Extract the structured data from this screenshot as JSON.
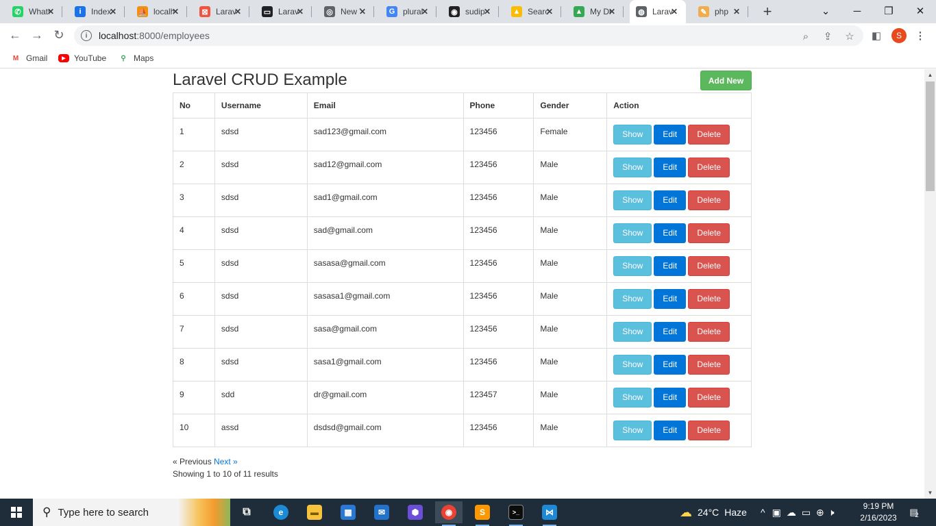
{
  "browser": {
    "tabs": [
      {
        "title": "WhatsApp",
        "icon": "whatsapp-icon",
        "color": "#25d366",
        "glyph": "✆",
        "active": false
      },
      {
        "title": "Index",
        "icon": "index-icon",
        "color": "#1a73e8",
        "glyph": "i",
        "active": false
      },
      {
        "title": "localhost",
        "icon": "phpmyadmin-icon",
        "color": "#f29111",
        "glyph": "⛵",
        "active": false
      },
      {
        "title": "Laravel",
        "icon": "laravel-icon",
        "color": "#f05340",
        "glyph": "⊠",
        "active": false
      },
      {
        "title": "Laravel",
        "icon": "laracasts-icon",
        "color": "#202124",
        "glyph": "▭",
        "active": false
      },
      {
        "title": "New Tab",
        "icon": "chrome-icon",
        "color": "#5f6368",
        "glyph": "◎",
        "active": false
      },
      {
        "title": "plural",
        "icon": "google-icon",
        "color": "#4285f4",
        "glyph": "G",
        "active": false
      },
      {
        "title": "sudip",
        "icon": "github-icon",
        "color": "#202124",
        "glyph": "◉",
        "active": false
      },
      {
        "title": "Search",
        "icon": "google-drive-icon",
        "color": "#fbbc04",
        "glyph": "▲",
        "active": false
      },
      {
        "title": "My Drive",
        "icon": "google-drive-icon",
        "color": "#34a853",
        "glyph": "▲",
        "active": false
      },
      {
        "title": "Laravel",
        "icon": "globe-icon",
        "color": "#5f6368",
        "glyph": "◍",
        "active": true
      },
      {
        "title": "php",
        "icon": "php-icon",
        "color": "#f0ad4e",
        "glyph": "✎",
        "active": false
      }
    ],
    "address": {
      "host": "localhost",
      "path": ":8000/employees"
    },
    "profile_initial": "S",
    "bookmarks": [
      {
        "label": "Gmail",
        "icon": "gmail-icon"
      },
      {
        "label": "YouTube",
        "icon": "youtube-icon"
      },
      {
        "label": "Maps",
        "icon": "maps-icon"
      }
    ]
  },
  "page": {
    "title": "Laravel CRUD Example",
    "add_new_label": "Add New",
    "columns": [
      "No",
      "Username",
      "Email",
      "Phone",
      "Gender",
      "Action"
    ],
    "rows": [
      {
        "no": "1",
        "username": "sdsd",
        "email": "sad123@gmail.com",
        "phone": "123456",
        "gender": "Female"
      },
      {
        "no": "2",
        "username": "sdsd",
        "email": "sad12@gmail.com",
        "phone": "123456",
        "gender": "Male"
      },
      {
        "no": "3",
        "username": "sdsd",
        "email": "sad1@gmail.com",
        "phone": "123456",
        "gender": "Male"
      },
      {
        "no": "4",
        "username": "sdsd",
        "email": "sad@gmail.com",
        "phone": "123456",
        "gender": "Male"
      },
      {
        "no": "5",
        "username": "sdsd",
        "email": "sasasa@gmail.com",
        "phone": "123456",
        "gender": "Male"
      },
      {
        "no": "6",
        "username": "sdsd",
        "email": "sasasa1@gmail.com",
        "phone": "123456",
        "gender": "Male"
      },
      {
        "no": "7",
        "username": "sdsd",
        "email": "sasa@gmail.com",
        "phone": "123456",
        "gender": "Male"
      },
      {
        "no": "8",
        "username": "sdsd",
        "email": "sasa1@gmail.com",
        "phone": "123456",
        "gender": "Male"
      },
      {
        "no": "9",
        "username": "sdd",
        "email": "dr@gmail.com",
        "phone": "123457",
        "gender": "Male"
      },
      {
        "no": "10",
        "username": "assd",
        "email": "dsdsd@gmail.com",
        "phone": "123456",
        "gender": "Male"
      }
    ],
    "action_labels": {
      "show": "Show",
      "edit": "Edit",
      "delete": "Delete"
    },
    "pagination": {
      "previous": "« Previous",
      "next": "Next »"
    },
    "summary": "Showing 1 to 10 of 11 results"
  },
  "taskbar": {
    "search_placeholder": "Type here to search",
    "weather": {
      "temp": "24°C",
      "condition": "Haze"
    },
    "clock": {
      "time": "9:19 PM",
      "date": "2/16/2023"
    },
    "notification_count": "2"
  },
  "colors": {
    "add_new": "#5cb85c",
    "show": "#5bc0de",
    "edit": "#0275d8",
    "delete": "#d9534f"
  }
}
